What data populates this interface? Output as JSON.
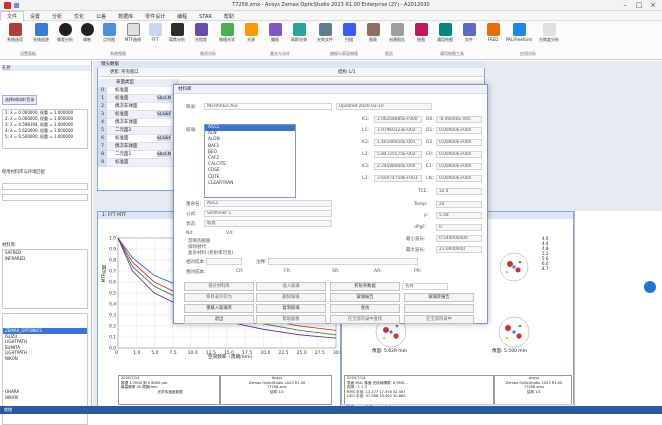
{
  "window": {
    "title": "T7258.zmx - Ansys Zemax OpticStudio 2023 R1.00   Enterprise (2Y) - A2012030"
  },
  "menu": [
    "文件",
    "设置",
    "分析",
    "优化",
    "公差",
    "数据库",
    "零件设计",
    "编程",
    "STAR",
    "帮助"
  ],
  "ribbon": {
    "buttons": [
      "系统选项",
      "实体模型",
      "光线追迹",
      "像差分析",
      "调制",
      "点列图",
      "MTF曲线",
      "FFT",
      "离焦分析",
      "光程差",
      "光学查看",
      "物理光学",
      "光源",
      "偏振",
      "高斯光束",
      "光束文件",
      "扫描",
      "图表",
      "扫描",
      "创建报告",
      "绘图",
      "自定义",
      "报表",
      "通用绘图",
      "文件",
      "FRED",
      "PAL/Freeform分析",
      "光焦度分析"
    ],
    "groups": [
      "设置面板",
      "系统视图",
      "像质分析",
      "激光与光纤",
      "偏振与表面物理",
      "杂散光分析",
      "报告",
      "通用绘图工具",
      "应用分析"
    ]
  },
  "left_panel": {
    "items": [
      "孔径",
      "视场",
      "波长",
      "环境",
      "偏振",
      "高级",
      "光线瞄准",
      "材料库",
      "",
      "",
      "",
      "",
      "INFRARED",
      "SCHOTT",
      "OHARA",
      "HOYA",
      "CDGM",
      "SUMITA",
      "LIGHTPATH",
      "NIKON",
      "ARCHER",
      "THORLABS",
      "ISUZU",
      "HIKARI"
    ],
    "wave_lines": [
      "1: λ = 0.000000, 权重 = 1.000000",
      "2: λ = 0.000000, 权重 = 1.000000",
      "3: λ = 4.598194, 权重 = 1.000000",
      "4: λ = 5.620000, 权重 = 1.000000",
      "5: λ = 6.500000, 权重 = 1.000000"
    ],
    "btn_glass": "选择材料库/目录",
    "label_catalog": "使用材料库与环境匹配",
    "catalog_label": "材料库:",
    "catalog_list": [
      "SAFRED",
      "INFRARED",
      "SCHOTT",
      "OHARA",
      "LIGHTPATH",
      "ISUZU",
      "ARCHER",
      "NIKON",
      "HIKARI"
    ],
    "highlighted": "ZEMAX_OPTONICS"
  },
  "lde": {
    "title": "镜头数据",
    "toolbar": "更新: 所有窗口",
    "config": "结构 1/1",
    "header": [
      "表面类型",
      "标注"
    ],
    "rows": [
      {
        "n": "0",
        "type": "标准面",
        "glass": ""
      },
      {
        "n": "1",
        "type": "标准面",
        "glass": "SILICN"
      },
      {
        "n": "2",
        "type": "偶次非球面",
        "glass": ""
      },
      {
        "n": "3",
        "type": "标准面",
        "glass": "SCGEF"
      },
      {
        "n": "4",
        "type": "偶次非球面",
        "glass": ""
      },
      {
        "n": "5",
        "type": "二元面2",
        "glass": ""
      },
      {
        "n": "6",
        "type": "标准面",
        "glass": "SCGEF"
      },
      {
        "n": "7",
        "type": "偶次非球面",
        "glass": ""
      },
      {
        "n": "8",
        "type": "二元面1",
        "glass": "SILICN"
      },
      {
        "n": "9",
        "type": "标准面",
        "glass": ""
      }
    ]
  },
  "dialog": {
    "title": "材料库",
    "catalog_label": "目录:",
    "catalog_value": "INFRARED.AGF",
    "updated": "Updated 2020-02-10",
    "glass_label": "玻璃:",
    "glass_list": [
      "AGCL",
      "ALN",
      "ALON",
      "BAF2",
      "BEO",
      "CAF2",
      "CALCITE",
      "CDSE",
      "CDTE",
      "CLEARTRAN"
    ],
    "selected": "AGCL",
    "rename_label": "重命名:",
    "rename_value": "AGCL",
    "formula_label": "公式:",
    "formula_value": "Sellmeier 1",
    "status_label": "状态:",
    "status_value": "标准",
    "nd_label": "Nd:",
    "vd_label": "Vd:",
    "check1": "忽略热膨胀",
    "check2": "排除替代",
    "check3": "复杂材料 (折射率可变)",
    "range_label": "相对成本:",
    "cr_label": "CR:",
    "fr_label": "FR:",
    "sr_label": "SR:",
    "ar_label": "AR:",
    "pr_label": "PR:",
    "comment_label": "注释:",
    "coeffs_left": [
      {
        "k": "K1:",
        "v": "2.06258880E+000"
      },
      {
        "k": "L1:",
        "v": "1.97960323E-002"
      },
      {
        "k": "K2:",
        "v": "1.46146050E-001"
      },
      {
        "k": "L2:",
        "v": "5.84725575E-002"
      },
      {
        "k": "K3:",
        "v": "2.24598000E-000"
      },
      {
        "k": "L3:",
        "v": "3.60074754E+003"
      }
    ],
    "coeffs_right": [
      {
        "k": "D0:",
        "v": "-8.00000E-005"
      },
      {
        "k": "D1:",
        "v": "0.00000E+000"
      },
      {
        "k": "D2:",
        "v": "0.00000E+000"
      },
      {
        "k": "E0:",
        "v": "0.00000E+000"
      },
      {
        "k": "E1:",
        "v": "0.00000E+000"
      },
      {
        "k": "Ltk:",
        "v": "0.00000E+000"
      }
    ],
    "tce_label": "TCE:",
    "tce_value": "32.4",
    "temp_label": "Temp:",
    "temp_value": "20",
    "p_label": "p:",
    "p_value": "5.58",
    "dpgf_label": "dPgF:",
    "dpgf_value": "0",
    "min_wl_label": "最小波长:",
    "min_wl_value": "0.540000000",
    "max_wl_label": "最大波长:",
    "max_wl_value": "21.0000000",
    "buttons": [
      [
        "保存材料库",
        "插入玻璃",
        "折射率数据",
        "排序"
      ],
      [
        "将目录另存为",
        "删除玻璃",
        "玻璃报告",
        "玻璃库报告"
      ],
      [
        "重载入玻璃库",
        "复制玻璃",
        "查找",
        ""
      ],
      [
        "退出",
        "帮助面板",
        "在全部目录中查找",
        "在全部目录中"
      ]
    ],
    "sort_value": "名称"
  },
  "mtf": {
    "title": "1: FFT MTF",
    "ylabel": "MTF的模",
    "xlabel": "空间频率（周期/mm）",
    "xticks": [
      "0",
      "1.0",
      "5.0",
      "7.5",
      "10.0",
      "12.5",
      "15.0",
      "17.5",
      "20.0",
      "22.5",
      "25.0",
      "27.5",
      "30.0"
    ],
    "yticks": [
      "1.0",
      "0.9",
      "0.8",
      "0.7",
      "0.6",
      "0.5",
      "0.4",
      "0.3",
      "0.2",
      "0.1",
      "0.0"
    ],
    "footer_lines": [
      "2025/7/14",
      "数据 1.7000 到 5.6000 µm.",
      "最高频率 30 周期/mm",
      "",
      "光学传递函数图"
    ],
    "footer_right": [
      "Ansys",
      "Zemax OpticStudio 2023 R1.00",
      "",
      "T7258.zmx",
      "结构 1/1"
    ]
  },
  "spot": {
    "title": "2: 点列图",
    "labels": [
      "像面: 5.629 mm",
      "像面: 5.590 mm"
    ],
    "table_lines": [
      "2025/7/14",
      "表面 IMA: 像面   光线间隔数: 6   RMS...",
      "视场    : 1   2   3",
      "RMS 半径: 13.377 17.556 32.587",
      "GEO 半径: 37.566 15.492 10.660"
    ],
    "legend": [
      "4.0",
      "4.4",
      "4.8",
      "5.2",
      "5.6",
      "6.0",
      "4.7"
    ],
    "tabs": [
      "图表",
      "分类",
      "文本"
    ]
  },
  "status": "就绪"
}
